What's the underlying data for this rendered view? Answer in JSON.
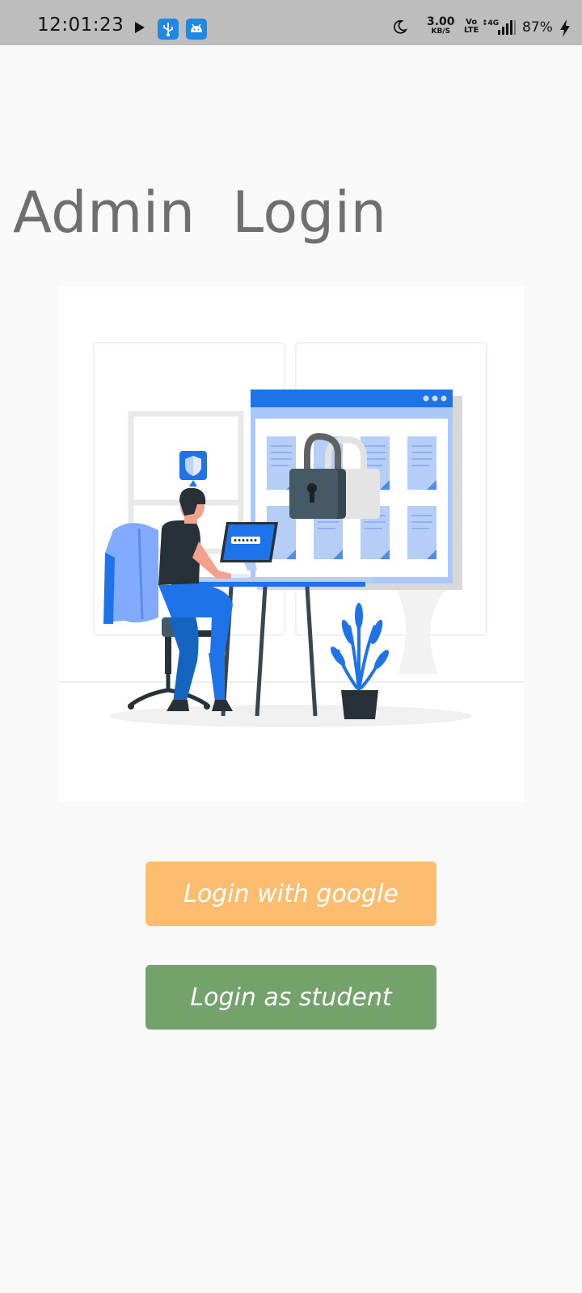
{
  "status_bar": {
    "time": "12:01:23",
    "network_speed_value": "3.00",
    "network_speed_unit": "KB/S",
    "volte_label": "Vo\nLTE",
    "network_type": "4G",
    "battery_percent": "87%",
    "icons": [
      "play-icon",
      "usb-icon",
      "android-icon",
      "moon-icon",
      "signal-icon",
      "charging-bolt-icon"
    ]
  },
  "page": {
    "title": "Admin  Login"
  },
  "illustration": {
    "icon": "person-at-computer-with-lock-illustration"
  },
  "buttons": {
    "google_label": "Login with google",
    "student_label": "Login as student"
  },
  "colors": {
    "google_button": "#fdbd6f",
    "student_button": "#73a36b",
    "title_text": "#6f6f6f",
    "accent_blue": "#1e88e5"
  }
}
